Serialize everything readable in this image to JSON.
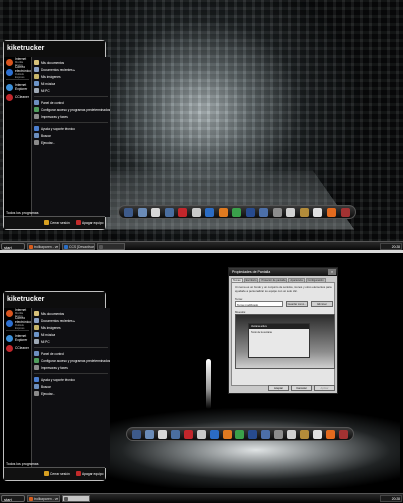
{
  "top": {
    "start_menu": {
      "username": "kiketrucker",
      "pinned": [
        {
          "label": "Internet",
          "sub": "Mozilla Firefox",
          "color": "#d9541e"
        },
        {
          "label": "Correo electrónico",
          "sub": "Outlook Express",
          "color": "#2c6fd1"
        },
        {
          "label": "Internet Explorer",
          "sub": "",
          "color": "#3b8fd8"
        },
        {
          "label": "CCleaner",
          "sub": "",
          "color": "#c2262b"
        }
      ],
      "right_items": [
        {
          "label": "Mis documentos",
          "color": "#d7c27a"
        },
        {
          "label": "Documentos recientes  ▸",
          "color": "#8aa0c4"
        },
        {
          "label": "Mis imágenes",
          "color": "#c8b66a"
        },
        {
          "label": "Mi música",
          "color": "#6c95c9"
        },
        {
          "label": "Mi PC",
          "color": "#9fa9b5"
        },
        {
          "label": "Panel de control",
          "color": "#6d8fc0"
        },
        {
          "label": "Configurar acceso y programas predeterminados",
          "color": "#4f9d5c"
        },
        {
          "label": "Impresoras y faxes",
          "color": "#8c8c8c"
        },
        {
          "label": "Ayuda y soporte técnico",
          "color": "#4b7fd1"
        },
        {
          "label": "Buscar",
          "color": "#6c8fbf"
        },
        {
          "label": "Ejecutar...",
          "color": "#8a8a8a"
        }
      ],
      "all_programs": "Todos los programas",
      "logoff": "Cerrar sesión",
      "shutdown": "Apagar equipo"
    },
    "taskbar": {
      "start": "start",
      "buttons": [
        {
          "label": "trollkaparen - ve la...",
          "active": false,
          "color": "#d85c1c"
        },
        {
          "label": "CCS [Desactivar]...",
          "active": false,
          "color": "#2a6fc7"
        },
        {
          "label": "",
          "active": false,
          "color": "#555555"
        }
      ],
      "clock": "20:28"
    }
  },
  "bottom": {
    "start_menu": {
      "username": "kiketrucker",
      "pinned": [
        {
          "label": "Internet",
          "sub": "Mozilla Firefox",
          "color": "#d9541e"
        },
        {
          "label": "Correo electrónico",
          "sub": "Outlook Express",
          "color": "#2c6fd1"
        },
        {
          "label": "Internet Explorer",
          "sub": "",
          "color": "#3b8fd8"
        },
        {
          "label": "CCleaner",
          "sub": "",
          "color": "#c2262b"
        }
      ],
      "right_items": [
        {
          "label": "Mis documentos",
          "color": "#d7c27a"
        },
        {
          "label": "Documentos recientes  ▸",
          "color": "#8aa0c4"
        },
        {
          "label": "Mis imágenes",
          "color": "#c8b66a"
        },
        {
          "label": "Mi música",
          "color": "#6c95c9"
        },
        {
          "label": "Mi PC",
          "color": "#9fa9b5"
        },
        {
          "label": "Panel de control",
          "color": "#6d8fc0"
        },
        {
          "label": "Configurar acceso y programas predeterminados",
          "color": "#4f9d5c"
        },
        {
          "label": "Impresoras y faxes",
          "color": "#8c8c8c"
        },
        {
          "label": "Ayuda y soporte técnico",
          "color": "#4b7fd1"
        },
        {
          "label": "Buscar",
          "color": "#6c8fbf"
        },
        {
          "label": "Ejecutar...",
          "color": "#8a8a8a"
        }
      ],
      "all_programs": "Todos los programas",
      "logoff": "Cerrar sesión",
      "shutdown": "Apagar equipo"
    },
    "dialog": {
      "title": "Propiedades de Pantalla",
      "tabs": [
        "Temas",
        "Escritorio",
        "Protector de pantalla",
        "Apariencia",
        "Configuración"
      ],
      "description": "Un tema es un fondo y un conjunto de sonidos, iconos y otros elementos para ayudarle a personalizar su equipo con un solo clic.",
      "theme_label": "Tema:",
      "theme_value": "Tema modificado",
      "save_as": "Guardar como...",
      "delete": "Eliminar",
      "preview_label": "Muestra:",
      "preview_window_title": "Ventana activa",
      "preview_window_text": "Texto de la ventana",
      "ok": "Aceptar",
      "cancel": "Cancelar",
      "apply": "Aplicar"
    },
    "taskbar": {
      "start": "start",
      "buttons": [
        {
          "label": "trollkaparen - ve la...",
          "active": false,
          "color": "#d85c1c"
        },
        {
          "label": "",
          "active": true,
          "color": "#555555"
        }
      ],
      "clock": "20:28"
    }
  },
  "dock_icons": [
    "#3d5a8a",
    "#6a8bb7",
    "#d7d7d7",
    "#4a6ea0",
    "#c2262b",
    "#c9c9c9",
    "#2b6cc4",
    "#e07a20",
    "#3aa04a",
    "#274b8f",
    "#4c6fa8",
    "#8c8c8c",
    "#d1d1d1",
    "#b38c3a",
    "#e0e0e0",
    "#e36a1e",
    "#a23232"
  ]
}
